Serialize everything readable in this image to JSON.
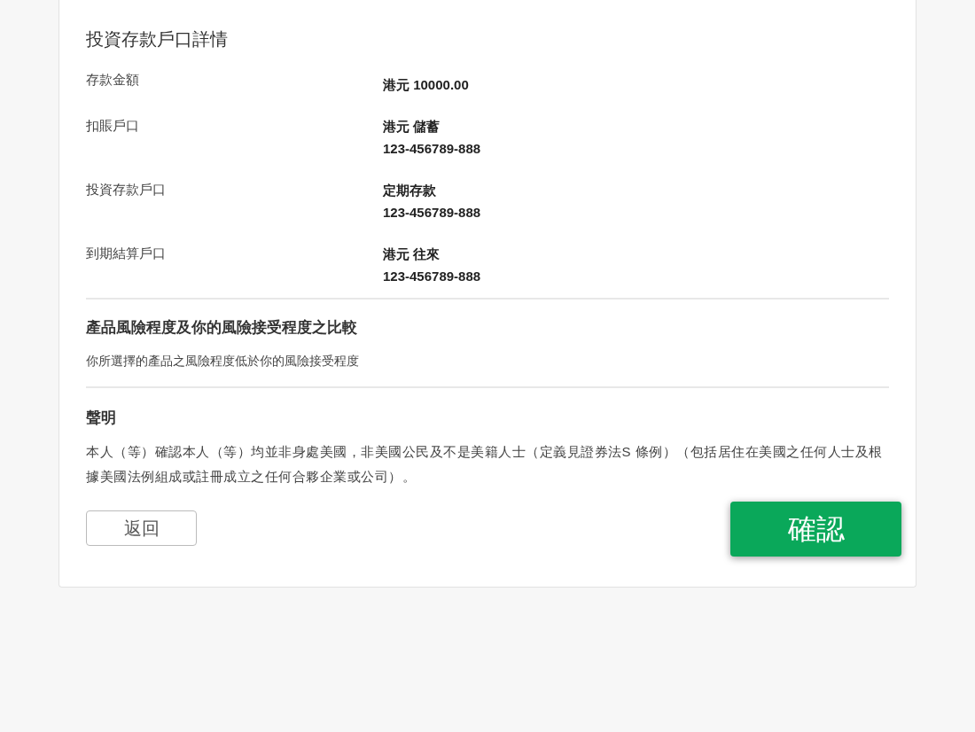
{
  "details": {
    "title": "投資存款戶口詳情",
    "rows": [
      {
        "label": "存款金額",
        "lines": [
          "港元 10000.00"
        ]
      },
      {
        "label": "扣賬戶口",
        "lines": [
          "港元 儲蓄",
          "123-456789-888"
        ]
      },
      {
        "label": "投資存款戶口",
        "lines": [
          "定期存款",
          "123-456789-888"
        ]
      },
      {
        "label": "到期結算戶口",
        "lines": [
          "港元 往來",
          "123-456789-888"
        ]
      }
    ]
  },
  "risk": {
    "title": "產品風險程度及你的風險接受程度之比較",
    "text": "你所選擇的產品之風險程度低於你的風險接受程度"
  },
  "declaration": {
    "title": "聲明",
    "text": "本人（等）確認本人（等）均並非身處美國，非美國公民及不是美籍人士（定義見證券法S 條例）（包括居住在美國之任何人士及根據美國法例組成或註冊成立之任何合夥企業或公司）。"
  },
  "buttons": {
    "back": "返回",
    "confirm": "確認"
  }
}
